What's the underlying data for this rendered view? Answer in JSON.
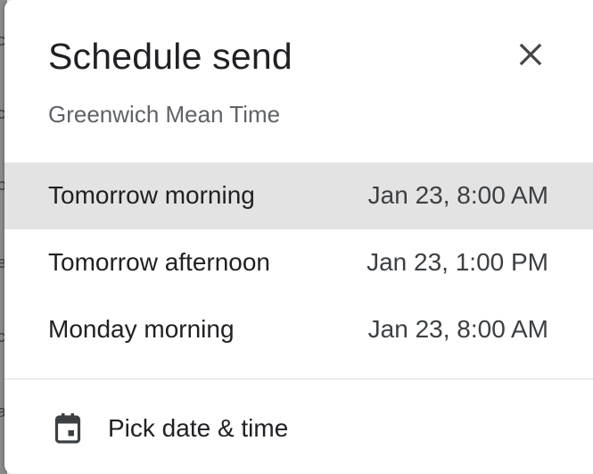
{
  "dialog": {
    "title": "Schedule send",
    "timezone": "Greenwich Mean Time",
    "close_icon": "close-icon",
    "options": [
      {
        "label": "Tomorrow morning",
        "time": "Jan 23, 8:00 AM",
        "selected": true
      },
      {
        "label": "Tomorrow afternoon",
        "time": "Jan 23, 1:00 PM",
        "selected": false
      },
      {
        "label": "Monday morning",
        "time": "Jan 23, 8:00 AM",
        "selected": false
      }
    ],
    "pick": {
      "label": "Pick date & time",
      "icon": "calendar-icon"
    }
  },
  "colors": {
    "selected_row": "#e3e3e3",
    "divider": "#dadce0",
    "secondary_text": "#5f6368"
  }
}
